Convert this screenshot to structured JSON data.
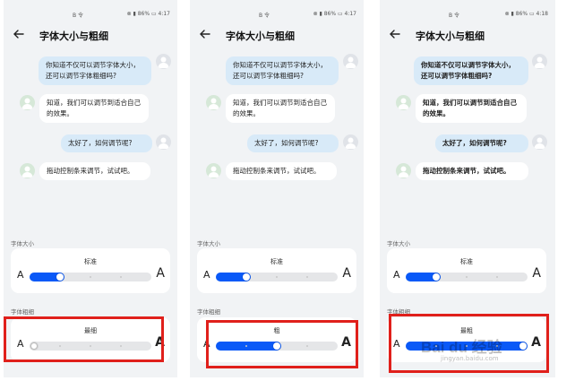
{
  "screens": [
    {
      "status_center": "B 令",
      "status_right": "⊗ ▮ 86% ▭ 4:17",
      "title": "字体大小与粗细",
      "messages": [
        "你知道不仅可以调节字体大小，还可以调节字体粗细吗?",
        "知道，我们可以调节到适合自己的效果。",
        "太好了，如何调节呢?",
        "拖动控制条来调节，试试吧。"
      ],
      "size_section_label": "字体大小",
      "size_level": "标准",
      "size_value": 0.25,
      "weight_section_label": "字体粗细",
      "weight_level": "最细",
      "weight_value": 0.0
    },
    {
      "status_center": "B 令",
      "status_right": "⊗ ▮ 86% ▭ 4:17",
      "title": "字体大小与粗细",
      "messages": [
        "你知道不仅可以调节字体大小，还可以调节字体粗细吗?",
        "知道，我们可以调节到适合自己的效果。",
        "太好了，如何调节呢?",
        "拖动控制条来调节，试试吧。"
      ],
      "size_section_label": "字体大小",
      "size_level": "标准",
      "size_value": 0.25,
      "weight_section_label": "字体粗细",
      "weight_level": "粗",
      "weight_value": 0.5
    },
    {
      "status_center": "B 令",
      "status_right": "⊗ ▮ 86% ▭ 4:18",
      "title": "字体大小与粗细",
      "messages": [
        "你知道不仅可以调节字体大小，还可以调节字体粗细吗?",
        "知道，我们可以调节到适合自己的效果。",
        "太好了，如何调节呢?",
        "拖动控制条来调节，试试吧。"
      ],
      "size_section_label": "字体大小",
      "size_level": "标准",
      "size_value": 0.25,
      "weight_section_label": "字体粗细",
      "weight_level": "最粗",
      "weight_value": 1.0
    }
  ],
  "letter_small": "A",
  "letter_big": "A",
  "watermark": {
    "text": "Bai du 经验",
    "url": "jingyan.baidu.com"
  },
  "colors": {
    "accent": "#0a59f7",
    "highlight": "#e0201b",
    "screen_bg": "#f1f3f5",
    "sent_bubble": "#d8eaf8"
  }
}
